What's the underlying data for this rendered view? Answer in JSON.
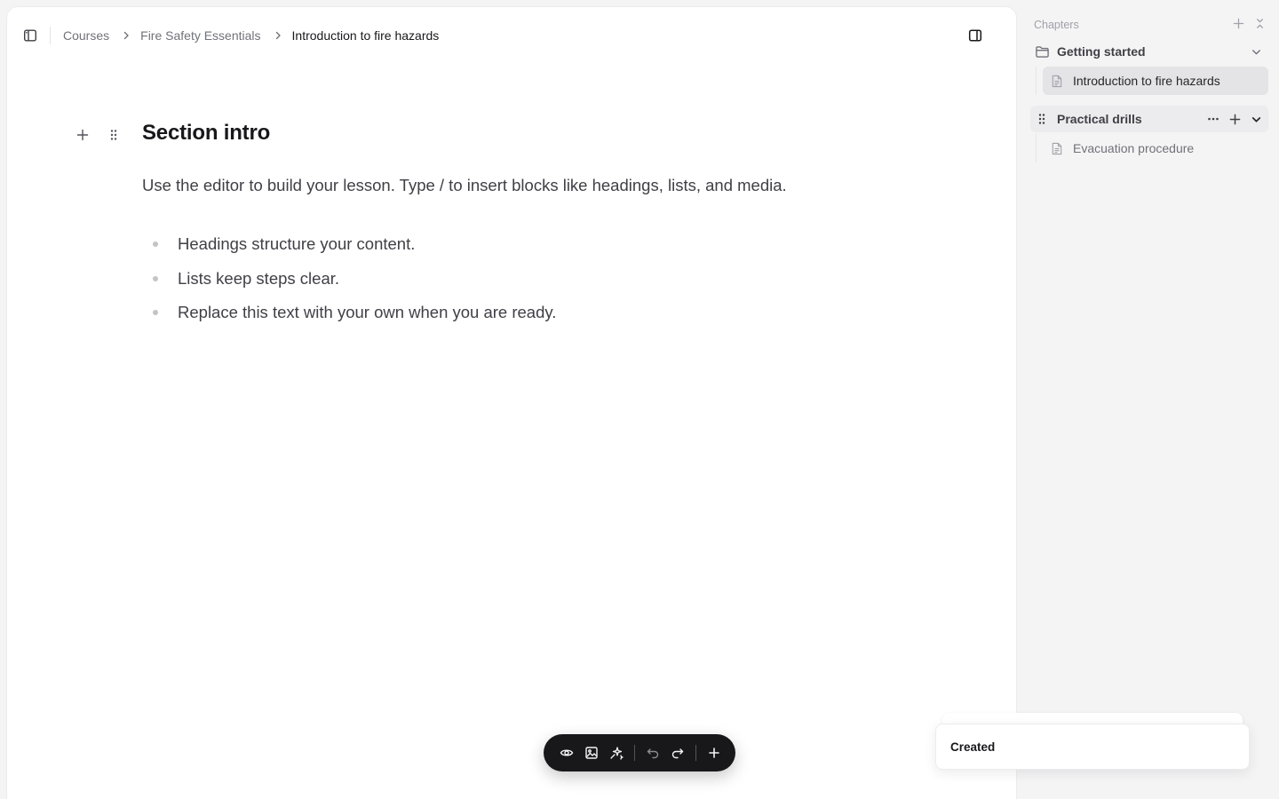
{
  "breadcrumb": {
    "items": [
      "Courses",
      "Fire Safety Essentials",
      "Introduction to fire hazards"
    ]
  },
  "editor": {
    "heading": "Section intro",
    "paragraph": "Use the editor to build your lesson. Type / to insert blocks like headings, lists, and media.",
    "bullets": [
      "Headings structure your content.",
      "Lists keep steps clear.",
      "Replace this text with your own when you are ready."
    ]
  },
  "toolbar": {
    "buttons": [
      "eye-icon",
      "image-icon",
      "sparkles-icon",
      "undo-icon",
      "redo-icon",
      "plus-icon"
    ]
  },
  "sidebar": {
    "title": "Chapters",
    "groups": [
      {
        "label": "Getting started",
        "items": [
          {
            "label": "Introduction to fire hazards",
            "active": true
          }
        ]
      },
      {
        "label": "Practical drills",
        "items": [
          {
            "label": "Evacuation procedure",
            "active": false
          }
        ]
      }
    ]
  },
  "toast": {
    "message": "Created"
  },
  "colors": {
    "background": "#f4f4f5",
    "surface": "#ffffff",
    "toolbar": "#18181b",
    "active_item": "#e4e4e7"
  }
}
